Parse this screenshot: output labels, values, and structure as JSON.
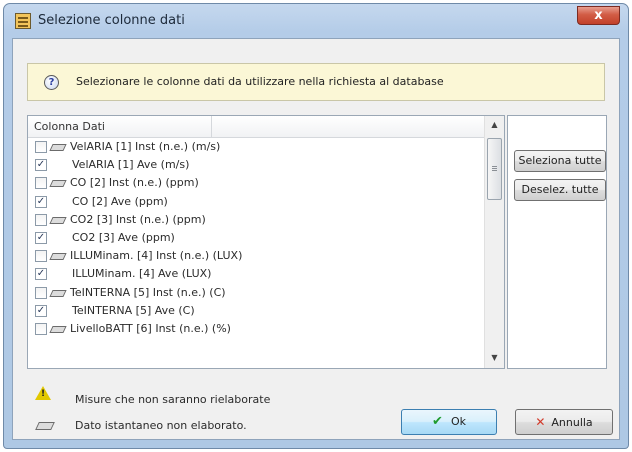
{
  "window": {
    "title": "Selezione colonne dati",
    "close_label": "x"
  },
  "info": {
    "text": "Selezionare le colonne dati da utilizzare nella richiesta al database",
    "icon": "question-icon"
  },
  "list": {
    "column_header": "Colonna Dati",
    "rows": [
      {
        "label": "VelARIA [1] Inst (n.e.) (m/s)",
        "checked": false,
        "raw": true
      },
      {
        "label": "VelARIA [1] Ave (m/s)",
        "checked": true,
        "raw": false
      },
      {
        "label": "CO [2] Inst (n.e.) (ppm)",
        "checked": false,
        "raw": true
      },
      {
        "label": "CO [2] Ave (ppm)",
        "checked": true,
        "raw": false
      },
      {
        "label": "CO2 [3] Inst (n.e.) (ppm)",
        "checked": false,
        "raw": true
      },
      {
        "label": "CO2 [3] Ave (ppm)",
        "checked": true,
        "raw": false
      },
      {
        "label": "ILLUMinam. [4] Inst (n.e.) (LUX)",
        "checked": false,
        "raw": true
      },
      {
        "label": "ILLUMinam. [4] Ave (LUX)",
        "checked": true,
        "raw": false
      },
      {
        "label": "TeINTERNA [5] Inst (n.e.) (C)",
        "checked": false,
        "raw": true
      },
      {
        "label": "TeINTERNA [5] Ave (C)",
        "checked": true,
        "raw": false
      },
      {
        "label": "LivelloBATT [6] Inst (n.e.) (%)",
        "checked": false,
        "raw": true
      }
    ],
    "scroll_up": "▲",
    "scroll_down": "▼"
  },
  "buttons": {
    "select_all": "Seleziona tutte",
    "deselect_all": "Deselez. tutte",
    "ok": "Ok",
    "cancel": "Annulla"
  },
  "legend": {
    "warning_text": "Misure che non saranno rielaborate",
    "raw_text": "Dato istantaneo non elaborato."
  },
  "colors": {
    "checkmark": "#2a3a5a",
    "ok_check": "#1f9b2e",
    "cancel_x": "#d23a2a",
    "info_bg": "#fbf7d6"
  }
}
